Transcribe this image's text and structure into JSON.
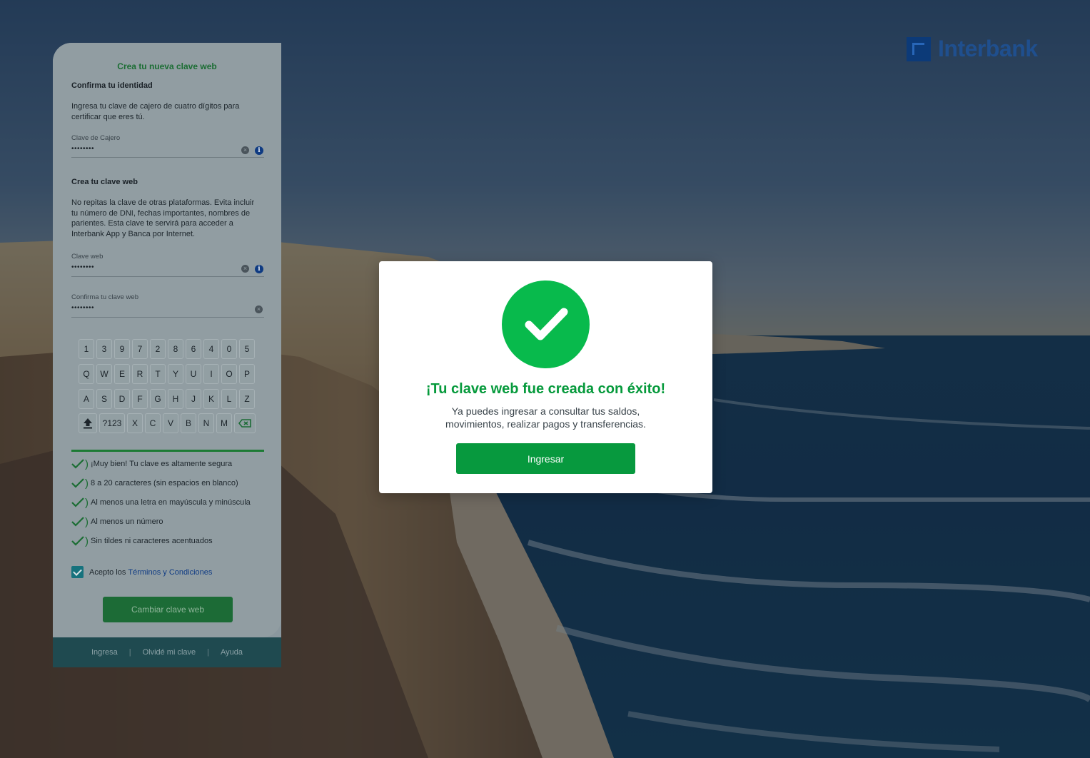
{
  "brand": {
    "name": "Interbank"
  },
  "form": {
    "title": "Crea tu nueva clave web",
    "identity_heading": "Confirma tu identidad",
    "identity_text": "Ingresa tu clave de cajero de cuatro dígitos para certificar que eres tú.",
    "cashier_label": "Clave de Cajero",
    "cashier_value": "••••••••",
    "web_heading": "Crea tu clave web",
    "web_text": "No repitas la clave de otras plataformas. Evita incluir tu número de DNI, fechas importantes, nombres de parientes. Esta clave te servirá para acceder a Interbank App y Banca por Internet.",
    "web_label": "Clave web",
    "web_value": "••••••••",
    "confirm_label": "Confirma tu clave web",
    "confirm_value": "••••••••"
  },
  "keyboard": {
    "row1": [
      "1",
      "3",
      "9",
      "7",
      "2",
      "8",
      "6",
      "4",
      "0",
      "5"
    ],
    "row2": [
      "Q",
      "W",
      "E",
      "R",
      "T",
      "Y",
      "U",
      "I",
      "O",
      "P"
    ],
    "row3": [
      "A",
      "S",
      "D",
      "F",
      "G",
      "H",
      "J",
      "K",
      "L",
      "Z"
    ],
    "row4": [
      "X",
      "C",
      "V",
      "B",
      "N",
      "M"
    ],
    "symbols_key": "?123",
    "shift_icon": "upload-arrow-icon",
    "backspace_icon": "backspace-icon"
  },
  "strength": {
    "level": 1.0,
    "color": "#1c7a34"
  },
  "rules": [
    {
      "text": "¡Muy bien! Tu clave es altamente segura"
    },
    {
      "text": "8 a 20 caracteres (sin espacios en blanco)"
    },
    {
      "text": "Al menos una letra en mayúscula y minúscula"
    },
    {
      "text": "Al menos un número"
    },
    {
      "text": "Sin tildes ni caracteres acentuados"
    }
  ],
  "terms": {
    "prefix": "Acepto los",
    "link": "Términos y Condiciones",
    "checked": true
  },
  "submit_label": "Cambiar clave web",
  "footer": {
    "links": [
      "Ingresa",
      "Olvidé mi clave",
      "Ayuda"
    ],
    "separator": "|"
  },
  "modal": {
    "title": "¡Tu clave web fue creada con éxito!",
    "text": "Ya puedes ingresar a consultar tus saldos, movimientos, realizar pagos y transferencias.",
    "button_label": "Ingresar",
    "icon": "check-circle-icon",
    "accent": "#08ba4c"
  }
}
